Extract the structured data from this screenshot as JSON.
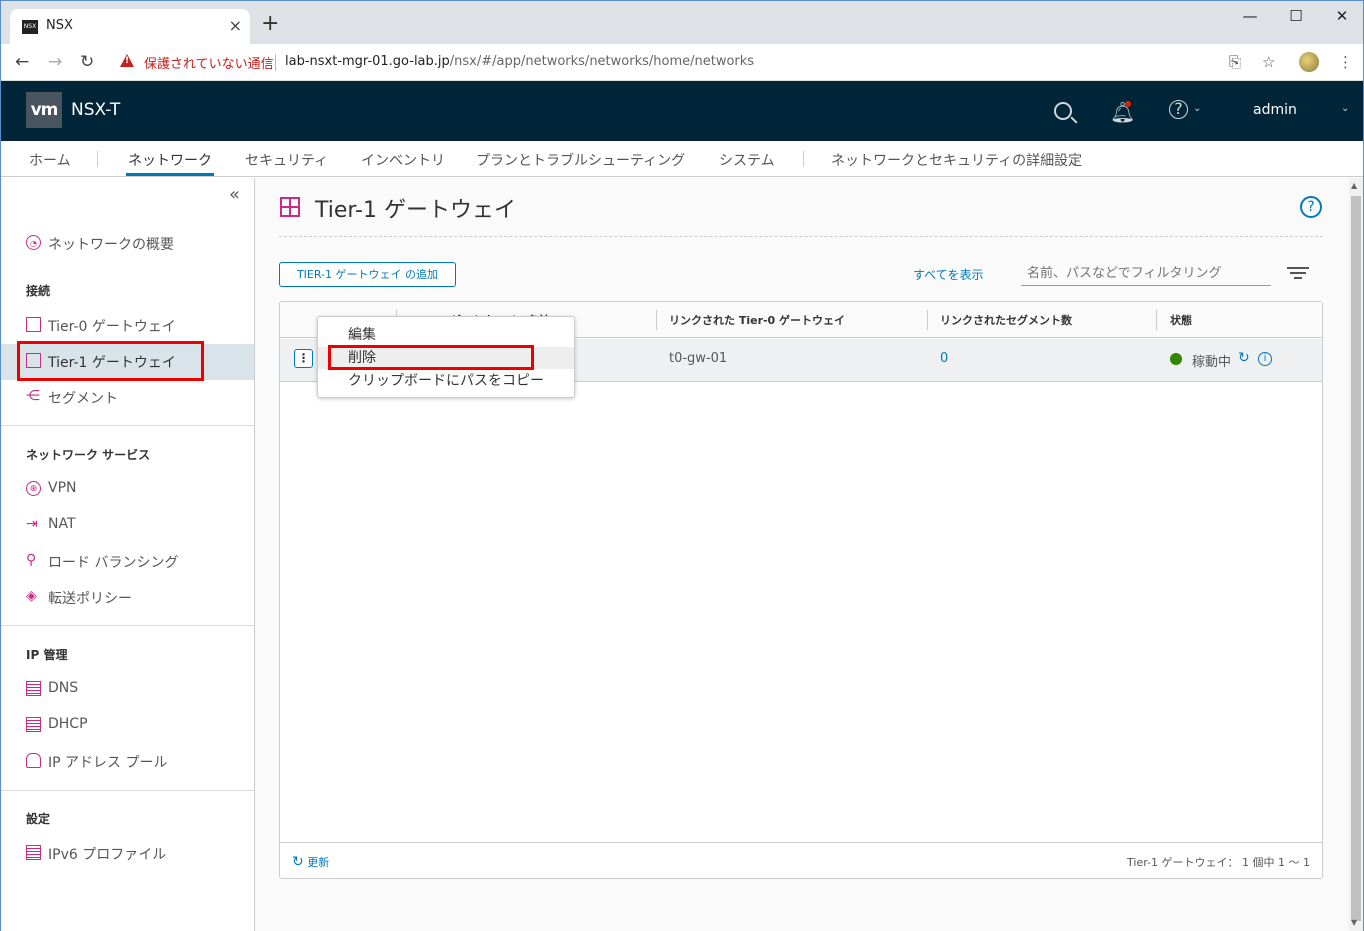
{
  "browser": {
    "tab_title": "NSX",
    "tab_favicon_text": "NSX",
    "address_warning": "保護されていない通信",
    "url_host": "lab-nsxt-mgr-01.go-lab.jp",
    "url_path": "/nsx/#/app/networks/networks/home/networks"
  },
  "header": {
    "logo": "vm",
    "app_title": "NSX-T",
    "user": "admin"
  },
  "topnav": {
    "items": [
      "ホーム",
      "ネットワーク",
      "セキュリティ",
      "インベントリ",
      "プランとトラブルシューティング",
      "システム",
      "ネットワークとセキュリティの詳細設定"
    ],
    "active": "ネットワーク"
  },
  "sidebar": {
    "overview": "ネットワークの概要",
    "sections": [
      {
        "heading": "接続",
        "items": [
          "Tier-0 ゲートウェイ",
          "Tier-1 ゲートウェイ",
          "セグメント"
        ]
      },
      {
        "heading": "ネットワーク サービス",
        "items": [
          "VPN",
          "NAT",
          "ロード バランシング",
          "転送ポリシー"
        ]
      },
      {
        "heading": "IP 管理",
        "items": [
          "DNS",
          "DHCP",
          "IP アドレス プール"
        ]
      },
      {
        "heading": "設定",
        "items": [
          "IPv6 プロファイル"
        ]
      }
    ],
    "active_item": "Tier-1 ゲートウェイ"
  },
  "main": {
    "title": "Tier-1 ゲートウェイ",
    "add_button": "TIER-1 ゲートウェイ の追加",
    "show_all": "すべてを表示",
    "filter_placeholder": "名前、パスなどでフィルタリング",
    "columns": [
      "Tier-1 ゲートウェイの名前",
      "リンクされた Tier-0 ゲートウェイ",
      "リンクされたセグメント数",
      "状態"
    ],
    "rows": [
      {
        "linked_tier0": "t0-gw-01",
        "segments": "0",
        "status": "稼動中"
      }
    ],
    "footer_refresh": "更新",
    "footer_count": "Tier-1 ゲートウェイ： 1 個中 1 ～ 1"
  },
  "context_menu": {
    "items": [
      "編集",
      "削除",
      "クリップボードにパスをコピー"
    ],
    "highlighted": "削除"
  },
  "colors": {
    "header_bg": "#002538",
    "accent": "#0079b8",
    "icon_magenta": "#c92b87",
    "status_green": "#318700",
    "highlight_red": "#e00000"
  }
}
